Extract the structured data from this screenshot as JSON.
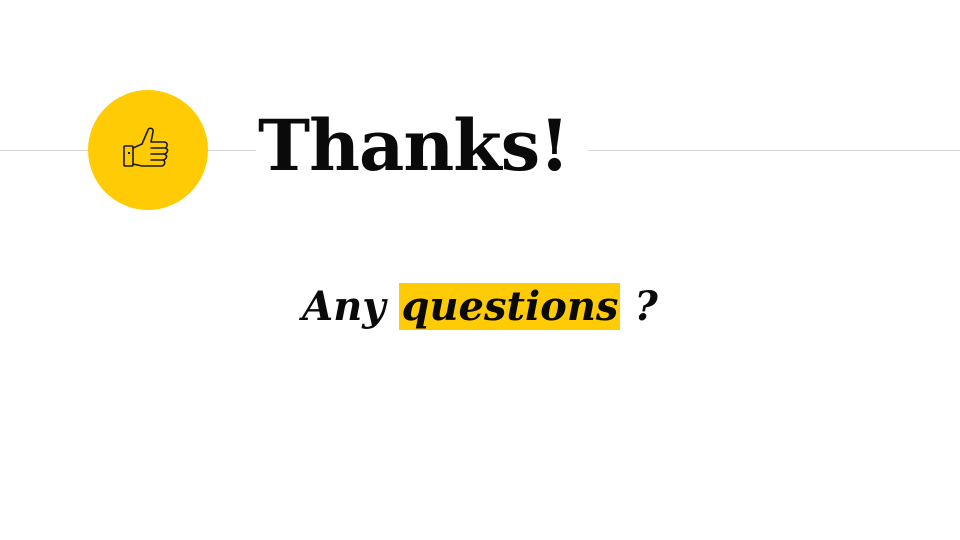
{
  "slide": {
    "title": "Thanks!",
    "subtitle_before": "Any ",
    "subtitle_highlight": "questions",
    "subtitle_after": " ?",
    "icon": "thumbs-up-icon",
    "colors": {
      "accent": "#ffcb05",
      "text": "#0a0a0a",
      "rule": "#d4d4d4",
      "background": "#ffffff"
    }
  }
}
